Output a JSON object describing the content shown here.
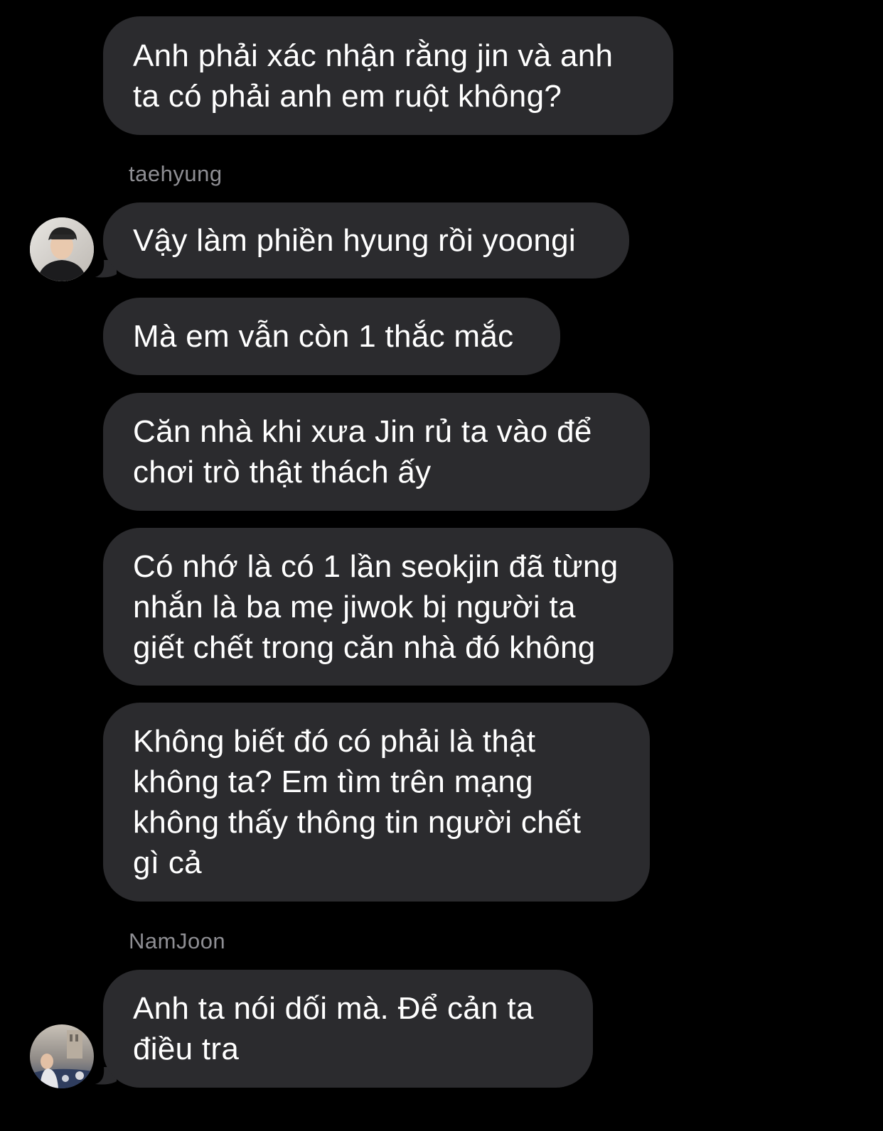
{
  "messages": [
    {
      "lines": [
        "Anh phải xác nhận rằng jin và anh",
        "ta có phải anh em ruột không?"
      ]
    },
    {
      "sender": "taehyung",
      "lines": [
        "Vậy làm phiền hyung rồi yoongi"
      ]
    },
    {
      "lines": [
        "Mà em vẫn còn 1 thắc mắc"
      ]
    },
    {
      "lines": [
        "Căn nhà khi xưa Jin rủ ta vào để",
        "chơi trò thật thách ấy"
      ]
    },
    {
      "lines": [
        "Có nhớ là có 1 lần seokjin đã từng",
        "nhắn là ba mẹ jiwok bị người ta",
        "giết chết trong căn nhà đó không"
      ]
    },
    {
      "lines": [
        "Không biết đó có phải là thật",
        "không ta? Em tìm trên mạng",
        "không thấy thông tin người chết",
        "gì cả"
      ]
    },
    {
      "sender": "NamJoon",
      "lines": [
        "Anh ta nói dối mà. Để cản ta",
        "điều tra"
      ]
    }
  ],
  "avatars": {
    "taehyung": "avatar-taehyung-photo",
    "namjoon": "avatar-namjoon-photo"
  },
  "colors": {
    "background": "#000000",
    "bubble": "#2b2b2e",
    "text": "#ffffff",
    "sender": "#8e8e93"
  }
}
